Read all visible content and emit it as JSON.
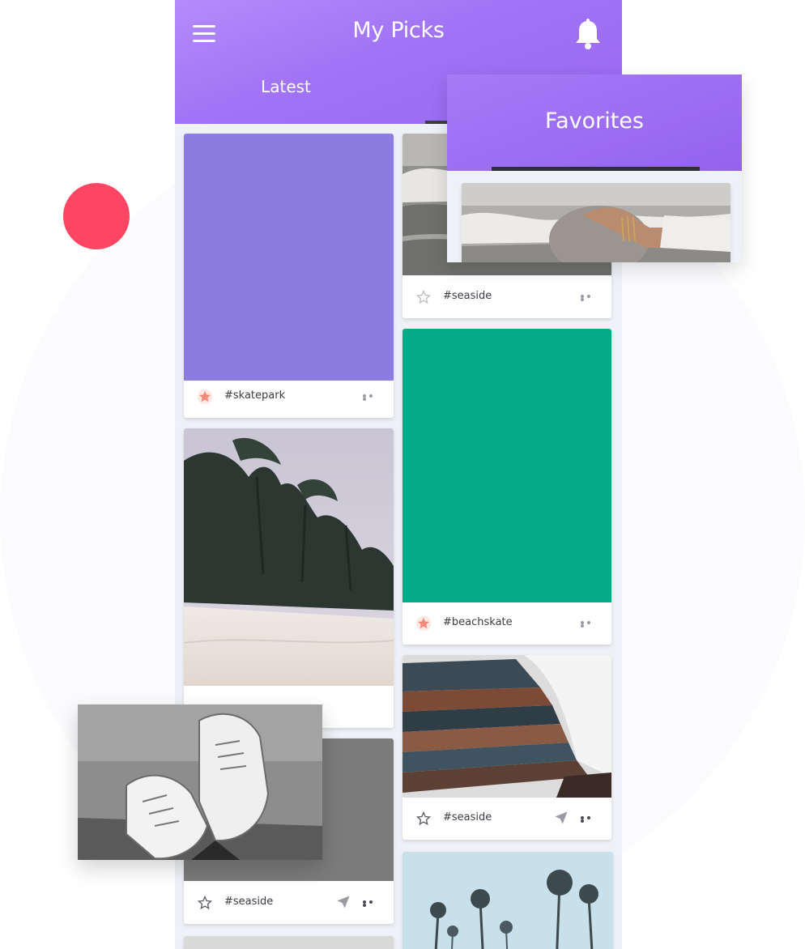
{
  "header": {
    "title": "My Picks",
    "tabs": [
      {
        "label": "Latest"
      },
      {
        "label": "Favorites"
      }
    ]
  },
  "cards": [
    {
      "tag": "#skatepark",
      "starred": true,
      "media": "solid",
      "color": "#8c7ce1"
    },
    {
      "tag": "#seaside",
      "starred": false,
      "media": "beach-waves-photo"
    },
    {
      "tag": "#beachskate",
      "starred": true,
      "media": "solid",
      "color": "#02aa86"
    },
    {
      "tag": "#seaside",
      "starred": false,
      "media": "stacked-books-photo"
    },
    {
      "tag": "#seaside",
      "starred": false,
      "media": "sneakers-photo"
    }
  ],
  "colors": {
    "accent": "#a173f5",
    "starred": "#f08b7a",
    "red_dot": "#fe4563"
  }
}
